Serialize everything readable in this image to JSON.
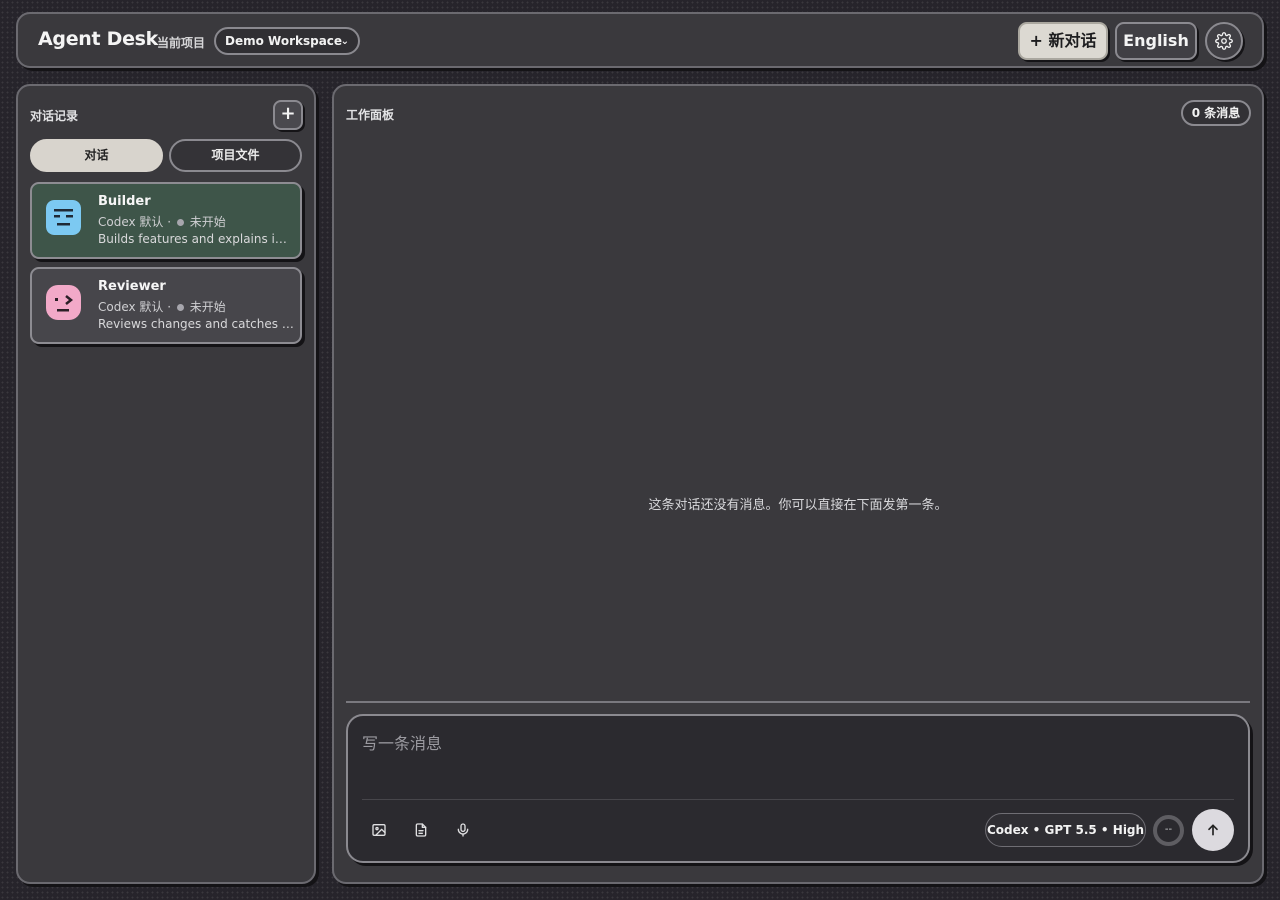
{
  "header": {
    "brand": "Agent Desk",
    "project_label": "当前项目",
    "workspace": "Demo Workspace",
    "new_chat_label": "+ 新对话",
    "language_label": "English",
    "settings_icon": "gear-icon"
  },
  "sidebar": {
    "title": "对话记录",
    "add_label": "+",
    "tabs": [
      {
        "label": "对话",
        "active": true
      },
      {
        "label": "项目文件",
        "active": false
      }
    ],
    "conversations": [
      {
        "name": "Builder",
        "engine": "Codex 默认 ·",
        "status": "未开始",
        "description": "Builds features and explains implementation",
        "avatar_color": "#7cc9f2",
        "card_color": "#3e5549",
        "selected": true
      },
      {
        "name": "Reviewer",
        "engine": "Codex 默认 ·",
        "status": "未开始",
        "description": "Reviews changes and catches problems",
        "avatar_color": "#f2a9c8",
        "card_color": "#47464b",
        "selected": false
      }
    ]
  },
  "main": {
    "title": "工作面板",
    "message_count": "0 条消息",
    "empty_text": "这条对话还没有消息。你可以直接在下面发第一条。"
  },
  "composer": {
    "placeholder": "写一条消息",
    "model": "Codex • GPT 5.5 • High",
    "context_indicator": "--",
    "tools": [
      "image-icon",
      "file-icon",
      "microphone-icon"
    ],
    "send_icon": "arrow-up-icon"
  },
  "colors": {
    "accent_button": "#dcd9d2",
    "panel": "#3a393d",
    "selected_card": "#3e5549"
  }
}
